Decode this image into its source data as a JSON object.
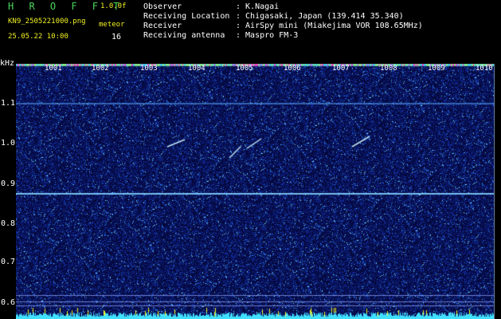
{
  "header": {
    "title": "H R O F F T",
    "version": "1.0.0f",
    "filename": "KN9_2505221000.png",
    "datetime": "25.05.22 10:00",
    "meteor_label": "meteor",
    "meteor_count": "16"
  },
  "info": [
    {
      "key": "Observer",
      "value": ": K.Nagai"
    },
    {
      "key": "Receiving Location",
      "value": ": Chigasaki, Japan (139.414 35.340)"
    },
    {
      "key": "Receiver",
      "value": ": AirSpy mini (Miakejima VOR 108.65MHz)"
    },
    {
      "key": "Receiving antenna",
      "value": ": Maspro FM-3"
    }
  ],
  "axis": {
    "unit": "kHz",
    "y_ticks": [
      "1.1",
      "1.0",
      "0.9",
      "0.8",
      "0.7",
      "0.6"
    ],
    "x_ticks": [
      "1001",
      "1002",
      "1003",
      "1004",
      "1005",
      "1006",
      "1007",
      "1008",
      "1009",
      "1010"
    ]
  },
  "colors": {
    "background": "#000000",
    "noise_dark": "#0a0f5a",
    "noise_bright": "#58e8ff",
    "title_green": "#49d65a",
    "label_yellow": "#f0f020"
  }
}
